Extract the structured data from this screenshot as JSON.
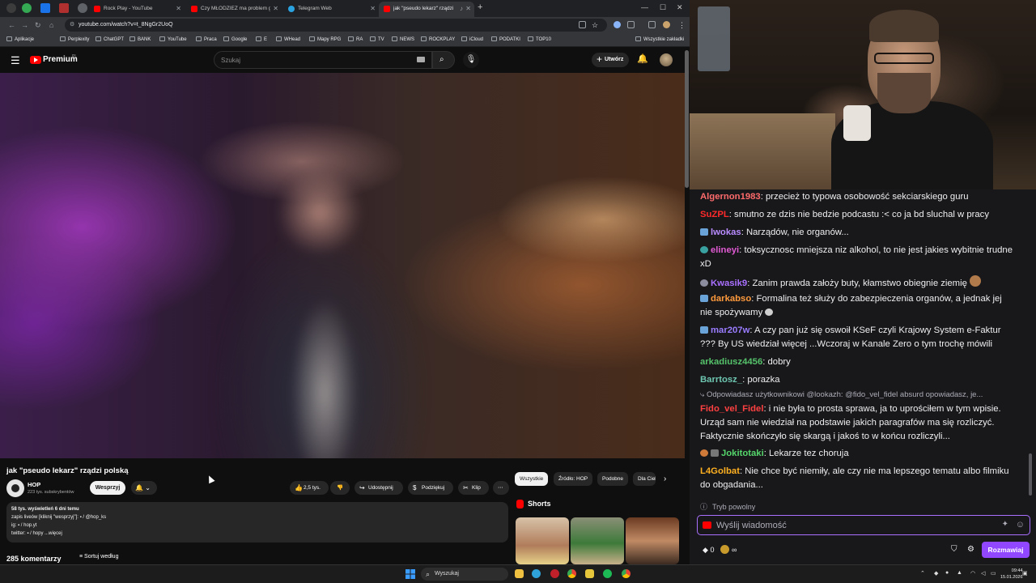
{
  "browser": {
    "tabs": [
      {
        "label": "Rock Play - YouTube",
        "active": false
      },
      {
        "label": "Czy MŁODZIEŻ ma problem ge",
        "active": false
      },
      {
        "label": "Telegram Web",
        "active": false
      },
      {
        "label": "jak \"pseudo lekarz\" rządzi p",
        "active": true
      }
    ],
    "url": "youtube.com/watch?v=t_8NgGr2UoQ",
    "bookmarks": [
      "Aplikacje",
      "Perplexity",
      "ChatGPT",
      "BANK",
      "YouTube",
      "Praca",
      "Google",
      "E",
      "WHead",
      "Mapy RPG",
      "RA",
      "TV",
      "NEWS",
      "ROCKPLAY",
      "iCloud",
      "PODATKI",
      "TOP10"
    ],
    "all_bookmarks": "Wszystkie zakładki"
  },
  "youtube": {
    "brand": "Premium",
    "country": "PL",
    "search_placeholder": "Szukaj",
    "create_label": "Utwórz",
    "video": {
      "title": "jak \"pseudo lekarz\" rządzi polską",
      "channel": "HOP",
      "subscribers": "223 tys. subskrybentów",
      "support_label": "Wesprzyj",
      "likes": "2,5 tys.",
      "share_label": "Udostępnij",
      "thanks_label": "Podziękuj",
      "clip_label": "Klip"
    },
    "description": {
      "stats": "58 tys. wyświetleń  6 dni temu",
      "line1": "zapis liveów [kliknij \"wesprzyj\"]:  ▪ / @hop_ks",
      "line2": "ig:  ▪ / hop.yt",
      "line3": "twitter:  ▪ / hopy ...więcej"
    },
    "comments_count": "285 komentarzy",
    "sort_label": "Sortuj według",
    "chips": [
      "Wszystkie",
      "Źródło: HOP",
      "Podobne",
      "Dla Ciebie"
    ],
    "shorts_title": "Shorts"
  },
  "taskbar": {
    "search": "Wyszukaj",
    "time": "09:44",
    "date": "15.01.2026"
  },
  "chat": {
    "messages": [
      {
        "user": "Algernon1983",
        "color": "#ff6b6b",
        "text": ": przecież to typowa osobowość sekciarskiego guru"
      },
      {
        "user": "SuZPL",
        "color": "#ff2a2a",
        "text": ": smutno ze dzis nie bedzie podcastu :< co ja bd sluchal w pracy"
      },
      {
        "user": "lwokas",
        "color": "#b98cff",
        "text": ": Narządów, nie organów..."
      },
      {
        "user": "elineyi",
        "color": "#e05ad2",
        "text": ": toksycznosc mniejsza niz alkohol, to nie jest jakies wybitnie trudne xD"
      },
      {
        "user": "Kwasik9",
        "color": "#a970ff",
        "text": ": Zanim prawda założy buty, kłamstwo obiegnie ziemię"
      },
      {
        "user": "darkabso",
        "color": "#ff9a3c",
        "text": ": Formalina też służy do zabezpieczenia organów, a jednak jej nie spożywamy"
      },
      {
        "user": "mar207w",
        "color": "#9a7cff",
        "text": ": A czy pan już się oswoił KSeF czyli Krajowy System e-Faktur ??? By US wiedział więcej ...Wczoraj w Kanale Zero o tym trochę mówili"
      },
      {
        "user": "arkadiusz4456",
        "color": "#55c26a",
        "text": ": dobry"
      },
      {
        "user": "Barrtosz_",
        "color": "#6ec6b0",
        "text": ": porazka"
      },
      {
        "user": "Fido_vel_Fidel",
        "color": "#ff4040",
        "text": ": i nie była to prosta sprawa, ja to uprościłem w tym wpisie. Urząd sam nie wiedział na podstawie jakich paragrafów ma się rozliczyć. Faktycznie skończyło się skargą i jakoś to w końcu rozliczyli..."
      },
      {
        "user": "Jokitotaki",
        "color": "#55d66b",
        "text": ": Lekarze tez choruja"
      },
      {
        "user": "L4Golbat",
        "color": "#ffb020",
        "text": ": Nie chce być niemiły, ale czy nie ma lepszego tematu albo filmiku do obgadania..."
      }
    ],
    "reply_context": "Odpowiadasz użytkownikowi @lookazh: @fido_vel_fidel absurd opowiadasz, je...",
    "slow_mode": "Tryb powolny",
    "input_placeholder": "Wyślij wiadomość",
    "points": "0",
    "infinity": "∞",
    "chat_button": "Rozmawiaj"
  }
}
